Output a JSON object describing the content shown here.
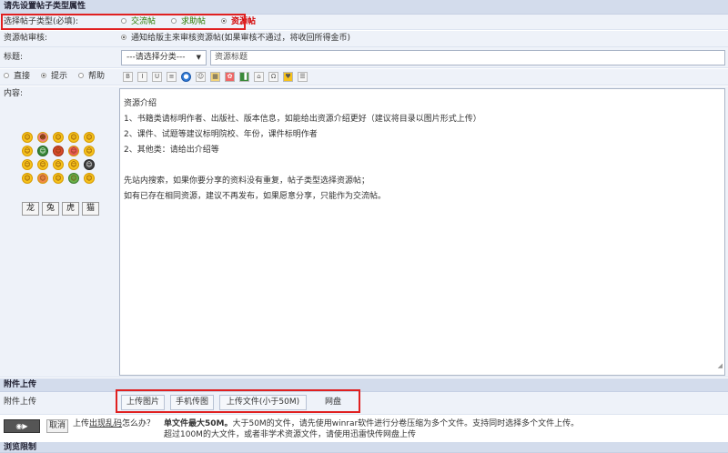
{
  "header": {
    "title": "请先设置帖子类型属性"
  },
  "post_type": {
    "label": "选择帖子类型(必填):",
    "options": [
      {
        "label": "交流帖",
        "color": "#2a7a00",
        "selected": false
      },
      {
        "label": "求助帖",
        "color": "#2a7a00",
        "selected": false
      },
      {
        "label": "资源帖",
        "color": "#d40000",
        "selected": true
      }
    ]
  },
  "review": {
    "label": "资源帖审核:",
    "text": "通知给版主来审核资源帖(如果审核不通过，将收回所得金币)"
  },
  "title_row": {
    "label": "标题:",
    "category_placeholder": "---请选择分类---",
    "title_value": "资源标题"
  },
  "mode": {
    "options": [
      "直接",
      "提示",
      "帮助"
    ],
    "selected": 1
  },
  "toolbar": {
    "icons": [
      "B",
      "I",
      "U",
      "≡",
      "●",
      "☺",
      "▦",
      "✿",
      "▐",
      "⌂",
      "Ω",
      "♥",
      "☰"
    ]
  },
  "content": {
    "label": "内容:",
    "lines": [
      "资源介绍",
      "1、书籍类请标明作者、出版社、版本信息，如能给出资源介绍更好（建议将目录以图片形式上传）",
      "2、课件、试题等建议标明院校、年份，课件标明作者",
      "2、其他类：请给出介绍等",
      "",
      "先站内搜索，如果你要分享的资料没有重复，帖子类型选择资源帖；",
      "如有已存在相同资源，建议不再发布，如果愿意分享，只能作为交流帖。"
    ]
  },
  "emoticons": [
    "☺",
    "☻",
    "☺",
    "☺",
    "☺",
    "☺",
    "☺",
    "☺",
    "☺",
    "☺",
    "☺",
    "☺",
    "☺",
    "☺",
    "☺",
    "☺",
    "☺",
    "☺",
    "☺",
    "☺"
  ],
  "animals": [
    "龙",
    "兔",
    "虎",
    "猫"
  ],
  "attachment": {
    "header": "附件上传",
    "label": "附件上传",
    "tabs": [
      "上传图片",
      "手机传图",
      "上传文件(小于50M)",
      "网盘"
    ]
  },
  "upload": {
    "cancel_label": "取消",
    "problem_prefix": "上传",
    "problem_link": "出现乱码",
    "problem_suffix": "怎么办？",
    "info_bold": "单文件最大50M。",
    "info_line1": "大于50M的文件，请先使用winrar软件进行分卷压缩为多个文件。支持同时选择多个文件上传。",
    "info_line2": "超过100M的大文件，或者非学术资源文件，请使用迅雷快传网盘上传"
  },
  "footer": {
    "title": "浏览限制"
  },
  "colors": {
    "header_bg": "#d3dcec",
    "row_bg": "#eef2f9",
    "highlight_red": "#e02020"
  }
}
